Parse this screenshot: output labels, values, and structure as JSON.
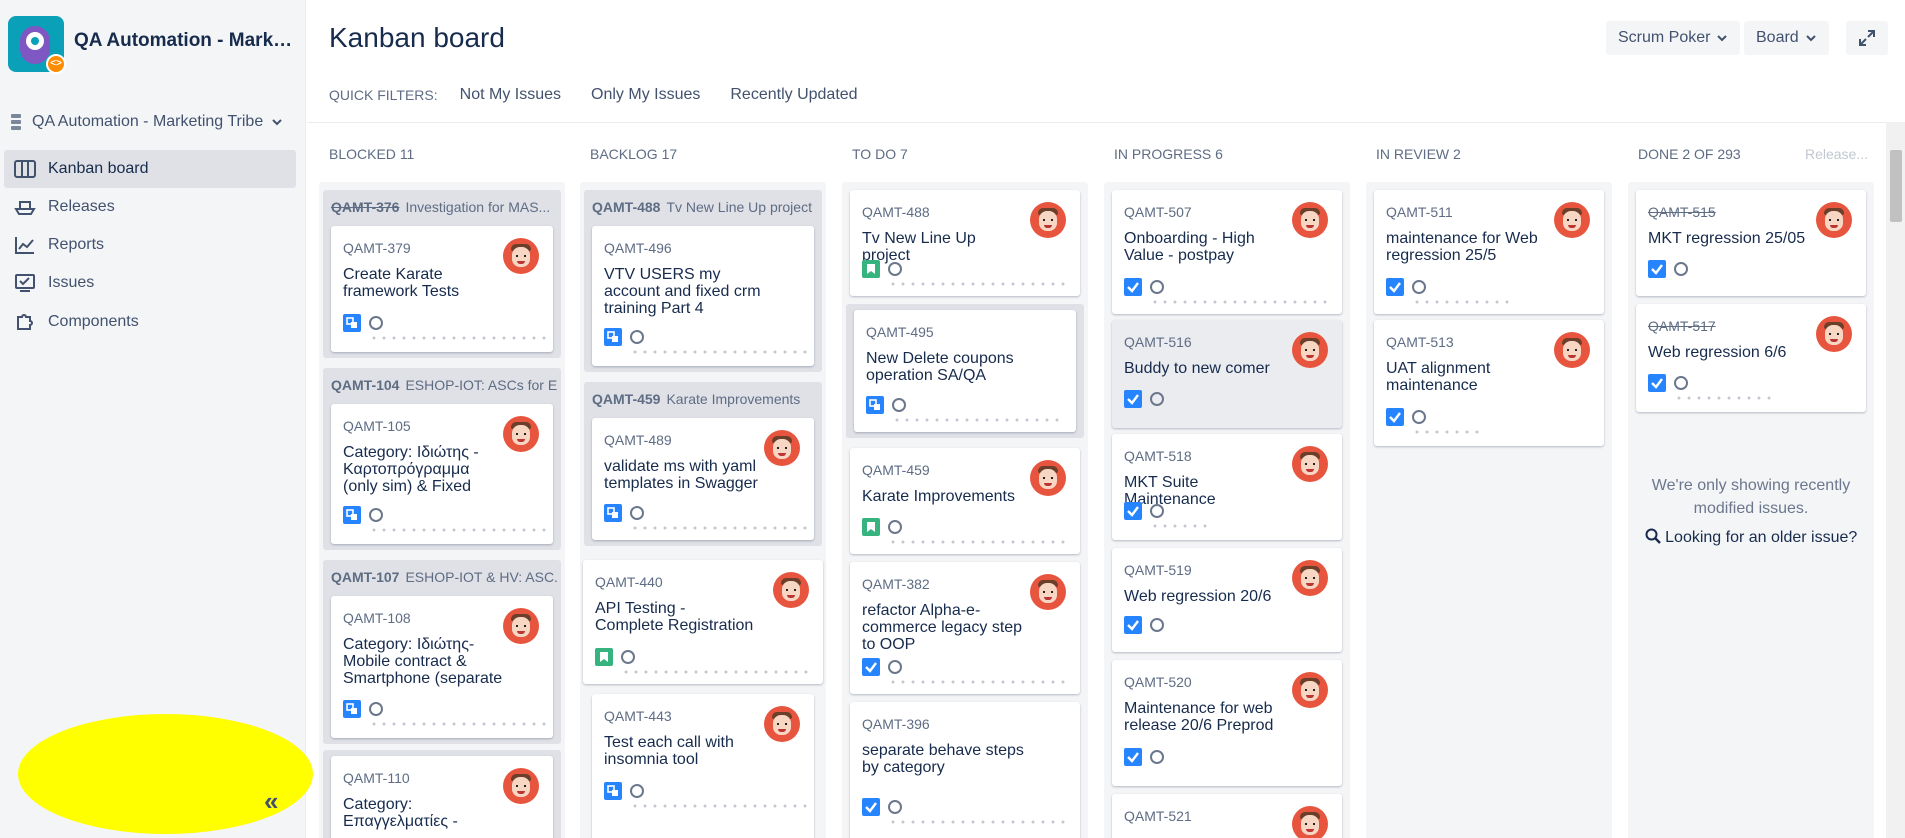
{
  "sidebar": {
    "project_title": "QA Automation - Marketing Tribe",
    "board_select": "QA Automation - Marketing Tribe",
    "nav": [
      {
        "label": "Kanban board",
        "icon": "board-icon",
        "active": true
      },
      {
        "label": "Releases",
        "icon": "ship-icon",
        "active": false
      },
      {
        "label": "Reports",
        "icon": "chart-line-icon",
        "active": false
      },
      {
        "label": "Issues",
        "icon": "issues-icon",
        "active": false
      },
      {
        "label": "Components",
        "icon": "puzzle-icon",
        "active": false
      }
    ],
    "collapse": "«"
  },
  "header": {
    "title": "Kanban board",
    "scrum_poker": "Scrum Poker",
    "board": "Board",
    "quick_filters_label": "QUICK FILTERS:",
    "filters": [
      "Not My Issues",
      "Only My Issues",
      "Recently Updated"
    ]
  },
  "columns": [
    {
      "name": "BLOCKED",
      "count": "11"
    },
    {
      "name": "BACKLOG",
      "count": "17"
    },
    {
      "name": "TO DO",
      "count": "7"
    },
    {
      "name": "IN PROGRESS",
      "count": "6"
    },
    {
      "name": "IN REVIEW",
      "count": "2"
    },
    {
      "name": "DONE",
      "count": "2 OF 293",
      "extra": "Release..."
    }
  ],
  "blocked": {
    "groups": [
      {
        "parent_key": "QAMT-376",
        "parent_title": "Investigation for MAS...",
        "card": {
          "key": "QAMT-379",
          "summary": "Create Karate framework Tests"
        }
      },
      {
        "parent_key": "QAMT-104",
        "parent_title": "ESHOP-IOT: ASCs for E...",
        "card": {
          "key": "QAMT-105",
          "summary": "Category: Ιδιώτης - Καρτοπρόγραμμα (only sim) & Fixed"
        }
      },
      {
        "parent_key": "QAMT-107",
        "parent_title": "ESHOP-IOT & HV: ASC...",
        "card": {
          "key": "QAMT-108",
          "summary": "Category: Ιδιώτης- Mobile contract & Smartphone (separate"
        }
      },
      {
        "card": {
          "key": "QAMT-110",
          "summary": "Category: Επαγγελματίες -"
        }
      }
    ]
  },
  "backlog": {
    "groups": [
      {
        "parent_key": "QAMT-488",
        "parent_title": "Tv New Line Up project",
        "card": {
          "key": "QAMT-496",
          "summary": "VTV USERS my account and fixed crm training Part 4"
        }
      },
      {
        "parent_key": "QAMT-459",
        "parent_title": "Karate Improvements",
        "card": {
          "key": "QAMT-489",
          "summary": "validate ms with yaml templates in Swagger"
        }
      }
    ],
    "cards": [
      {
        "key": "QAMT-440",
        "summary": "API Testing - Complete Registration"
      },
      {
        "key": "QAMT-443",
        "summary": "Test each call with insomnia tool"
      }
    ]
  },
  "todo": {
    "cards": [
      {
        "key": "QAMT-488",
        "summary": "Tv New Line Up project"
      },
      {
        "key": "QAMT-495",
        "summary": "New Delete coupons operation SA/QA"
      },
      {
        "key": "QAMT-459",
        "summary": "Karate Improvements"
      },
      {
        "key": "QAMT-382",
        "summary": "refactor Alpha-e-commerce legacy step to OOP"
      },
      {
        "key": "QAMT-396",
        "summary": "separate behave steps by category"
      }
    ]
  },
  "inprogress": {
    "cards": [
      {
        "key": "QAMT-507",
        "summary": "Onboarding - High Value - postpay"
      },
      {
        "key": "QAMT-516",
        "summary": "Buddy to new comer"
      },
      {
        "key": "QAMT-518",
        "summary": "MKT Suite Maintenance"
      },
      {
        "key": "QAMT-519",
        "summary": "Web regression 20/6"
      },
      {
        "key": "QAMT-520",
        "summary": "Maintenance for web release 20/6 Preprod"
      },
      {
        "key": "QAMT-521",
        "summary": ""
      }
    ]
  },
  "inreview": {
    "cards": [
      {
        "key": "QAMT-511",
        "summary": "maintenance for Web regression 25/5"
      },
      {
        "key": "QAMT-513",
        "summary": "UAT alignment maintenance"
      }
    ]
  },
  "done": {
    "cards": [
      {
        "key": "QAMT-515",
        "summary": "MKT regression 25/05"
      },
      {
        "key": "QAMT-517",
        "summary": "Web regression 6/6"
      }
    ],
    "note": "We're only showing recently modified issues.",
    "older": "Looking for an older issue?"
  },
  "colors": {
    "accent": "#0052cc",
    "avatar": "#e8553e",
    "story": "#36b37e",
    "task": "#2684ff",
    "highlight": "#ffff00"
  }
}
